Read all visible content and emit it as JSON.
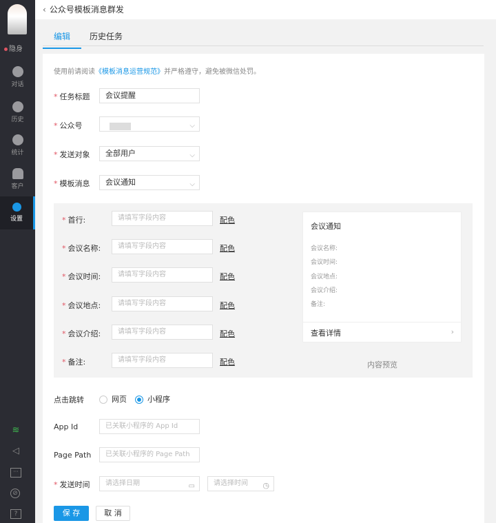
{
  "sidebar": {
    "status": "隐身",
    "items": [
      {
        "label": "对话",
        "icon": "chat-icon"
      },
      {
        "label": "历史",
        "icon": "clock-icon"
      },
      {
        "label": "统计",
        "icon": "pie-chart-icon"
      },
      {
        "label": "客户",
        "icon": "contacts-icon"
      },
      {
        "label": "设置",
        "icon": "gear-icon",
        "active": true
      }
    ],
    "bottom_icons": [
      "wifi-icon",
      "megaphone-icon",
      "message-icon",
      "link-icon",
      "help-icon"
    ]
  },
  "header": {
    "title": "公众号模板消息群发"
  },
  "tabs": [
    {
      "label": "编辑",
      "active": true
    },
    {
      "label": "历史任务"
    }
  ],
  "notice": {
    "prefix": "使用前请阅读",
    "link": "《模板消息运营规范》",
    "suffix": "并严格遵守，避免被微信处罚。"
  },
  "form": {
    "task_title": {
      "label": "任务标题",
      "value": "会议提醒"
    },
    "account": {
      "label": "公众号",
      "value": ""
    },
    "target": {
      "label": "发送对象",
      "value": "全部用户"
    },
    "template": {
      "label": "模板消息",
      "value": "会议通知"
    },
    "fields": [
      {
        "label": "首行:"
      },
      {
        "label": "会议名称:"
      },
      {
        "label": "会议时间:"
      },
      {
        "label": "会议地点:"
      },
      {
        "label": "会议介绍:"
      },
      {
        "label": "备注:"
      }
    ],
    "field_placeholder": "请填写字段内容",
    "color_label": "配色",
    "jump": {
      "label": "点击跳转",
      "options": [
        "网页",
        "小程序"
      ],
      "selected": "小程序"
    },
    "app_id": {
      "label": "App Id",
      "placeholder": "已关联小程序的 App Id"
    },
    "page_path": {
      "label": "Page Path",
      "placeholder": "已关联小程序的 Page Path"
    },
    "send_time": {
      "label": "发送时间",
      "date_placeholder": "请选择日期",
      "time_placeholder": "请选择时间"
    },
    "save": "保 存",
    "cancel": "取 消"
  },
  "preview": {
    "title": "会议通知",
    "fields": [
      "会议名称:",
      "会议时间:",
      "会议地点:",
      "会议介绍:",
      "备注:"
    ],
    "link": "查看详情",
    "caption": "内容预览"
  },
  "colors": {
    "accent": "#1a97e6",
    "required": "#e05563",
    "sidebar": "#2b2c33"
  }
}
